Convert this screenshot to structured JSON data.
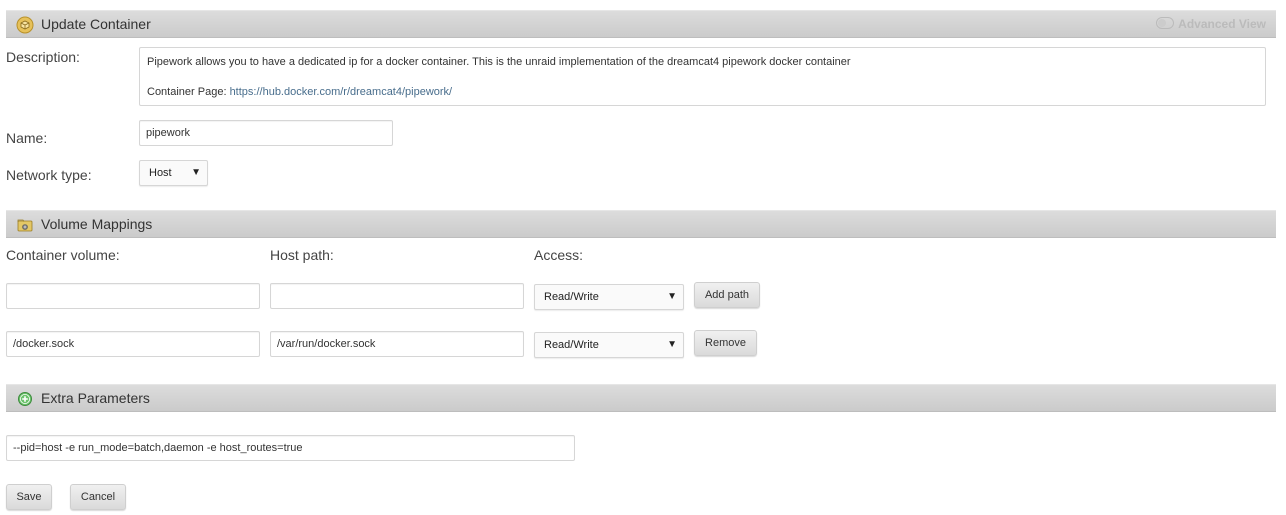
{
  "update_container": {
    "title": "Update Container",
    "advanced_view_label": "Advanced View",
    "description_label": "Description:",
    "description_text": "Pipework allows you to have a dedicated ip for a docker container. This is the unraid implementation of the dreamcat4 pipework docker container",
    "container_page_prefix": "Container Page: ",
    "container_page_url": "https://hub.docker.com/r/dreamcat4/pipework/",
    "name_label": "Name:",
    "name_value": "pipework",
    "network_type_label": "Network type:",
    "network_type_value": "Host"
  },
  "volume_mappings": {
    "title": "Volume Mappings",
    "col_container": "Container volume:",
    "col_host": "Host path:",
    "col_access": "Access:",
    "rows": [
      {
        "container": "",
        "host": "",
        "access": "Read/Write",
        "button": "Add path"
      },
      {
        "container": "/docker.sock",
        "host": "/var/run/docker.sock",
        "access": "Read/Write",
        "button": "Remove"
      }
    ]
  },
  "extra_parameters": {
    "title": "Extra Parameters",
    "value": "--pid=host -e run_mode=batch,daemon -e host_routes=true"
  },
  "footer": {
    "save": "Save",
    "cancel": "Cancel"
  },
  "icons": {
    "update": "box-icon",
    "volume": "folder-icon",
    "extra": "plus-circle-icon"
  },
  "colors": {
    "header_bg": "#d3d3d3",
    "link": "#486d8c",
    "add_icon": "#5cb85c"
  }
}
